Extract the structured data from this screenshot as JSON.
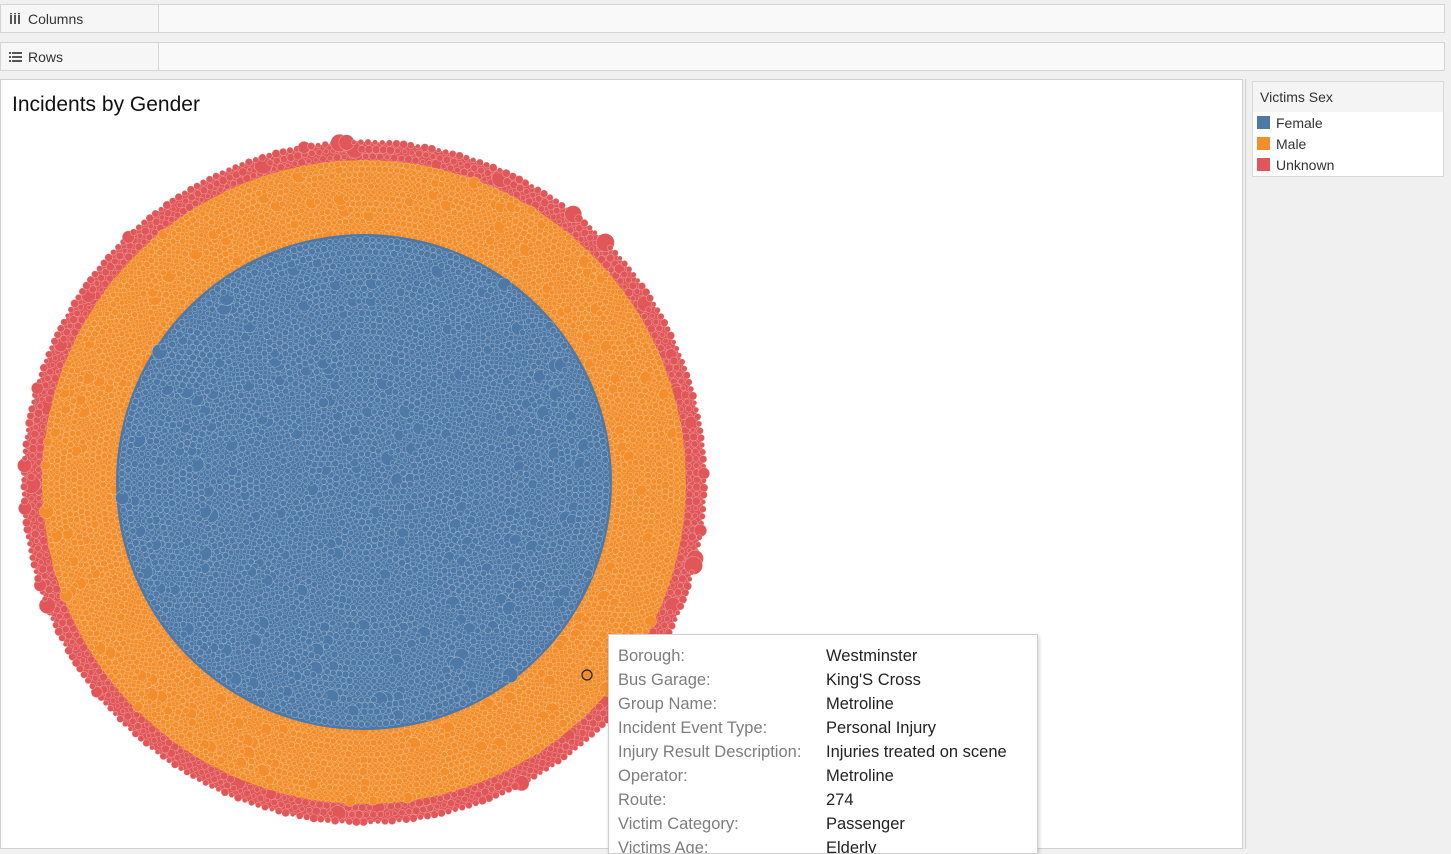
{
  "shelves": {
    "columns_label": "Columns",
    "rows_label": "Rows",
    "columns_icon": "columns-shelf-icon",
    "rows_icon": "rows-shelf-icon"
  },
  "viz": {
    "title": "Incidents by Gender"
  },
  "legend": {
    "title": "Victims Sex",
    "items": [
      {
        "label": "Female",
        "color": "#4e79a7"
      },
      {
        "label": "Male",
        "color": "#f28e2b"
      },
      {
        "label": "Unknown",
        "color": "#e15759"
      }
    ]
  },
  "tooltip": {
    "rows": [
      {
        "key": "Borough:",
        "value": "Westminster"
      },
      {
        "key": "Bus Garage:",
        "value": "King'S Cross"
      },
      {
        "key": "Group Name:",
        "value": "Metroline"
      },
      {
        "key": "Incident Event Type:",
        "value": "Personal Injury"
      },
      {
        "key": "Injury Result Description:",
        "value": "Injuries treated on scene"
      },
      {
        "key": "Operator:",
        "value": "Metroline"
      },
      {
        "key": "Route:",
        "value": "274"
      },
      {
        "key": "Victim Category:",
        "value": "Passenger"
      },
      {
        "key": "Victims Age:",
        "value": "Elderly"
      }
    ]
  },
  "chart_data": {
    "type": "packed-bubble",
    "title": "Incidents by Gender",
    "color_by": "Victims Sex",
    "series": [
      {
        "name": "Female",
        "color": "#4e79a7",
        "ring": "inner"
      },
      {
        "name": "Male",
        "color": "#f28e2b",
        "ring": "middle"
      },
      {
        "name": "Unknown",
        "color": "#e15759",
        "ring": "outer"
      }
    ]
  }
}
